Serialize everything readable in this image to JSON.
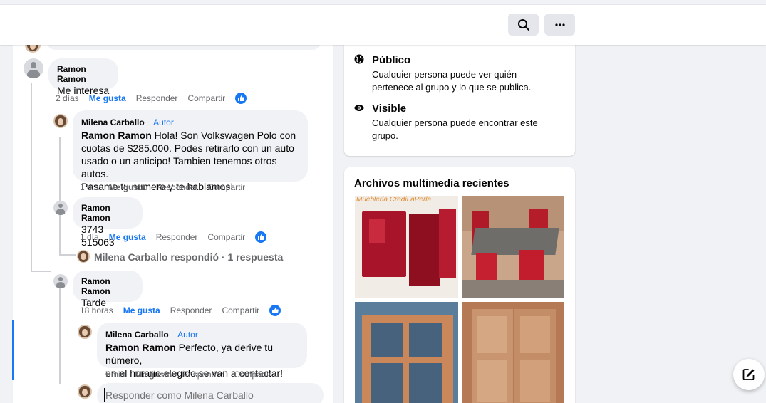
{
  "topbar": {
    "search_icon": "search-icon",
    "more_icon": "more-icon"
  },
  "comments": [
    {
      "name": "Ramon Ramon",
      "text": "Me interesa",
      "time": "2 días",
      "like": "Me gusta",
      "reply": "Responder",
      "share": "Compartir"
    },
    {
      "name": "Milena Carballo",
      "author_badge": "Autor",
      "mention": "Ramon Ramon",
      "text_lines": [
        " Hola! Son Volkswagen Polo con",
        "cuotas de $285.000. Podes retirarlo con un auto",
        "usado o un anticipo! Tambien tenemos otros autos.",
        "Pasame tu numero y te hablamos!"
      ],
      "time": "1 día",
      "like": "Me gusta",
      "reply": "Responder",
      "share": "Compartir"
    },
    {
      "name": "Ramon Ramon",
      "text": "3743 515063",
      "time": "1 día",
      "like": "Me gusta",
      "reply": "Responder",
      "share": "Compartir"
    },
    {
      "name": "Ramon Ramon",
      "text": "Tarde",
      "time": "18 horas",
      "like": "Me gusta",
      "reply": "Responder",
      "share": "Compartir"
    },
    {
      "name": "Milena Carballo",
      "author_badge": "Autor",
      "mention": "Ramon Ramon",
      "text_lines": [
        " Perfecto, ya derive tu número,",
        "en el horario elegido se van a contactar!"
      ],
      "time": "1 min",
      "like": "Me gusta",
      "reply": "Responder",
      "share": "Compartir"
    }
  ],
  "replies_summary": "Milena Carballo respondió · 1 respuesta",
  "reply_input": {
    "placeholder": "Responder como Milena Carballo"
  },
  "privacy": {
    "public_title": "Público",
    "public_desc_lines": [
      "Cualquier persona puede ver quién",
      "pertenece al grupo y lo que se publica."
    ],
    "visible_title": "Visible",
    "visible_desc_lines": [
      "Cualquier persona puede encontrar este",
      "grupo."
    ]
  },
  "media": {
    "title": "Archivos multimedia recientes",
    "watermark": "Muebleria CrediLaPerla"
  },
  "colors": {
    "accent": "#1877f2",
    "secondary_text": "#65676b",
    "bubble": "#f0f2f5"
  }
}
